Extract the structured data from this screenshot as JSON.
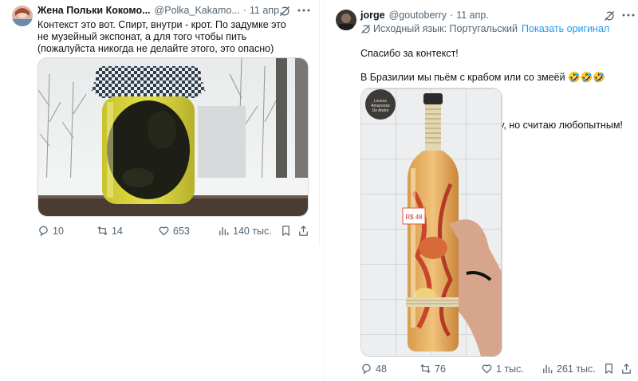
{
  "tweet1": {
    "author_name": "Жена Польки Кокомо...",
    "handle": "@Polka_Kakamo...",
    "separator": "·",
    "date": "11 апр.",
    "text": "Контекст это вот. Спирт, внутри - крот. По задумке это\nне музейный экспонат, а для того чтобы пить\n(пожалуйста никогда не делайте этого, это опасно)",
    "stats": {
      "replies": "10",
      "retweets": "14",
      "likes": "653",
      "views": "140 тыс."
    }
  },
  "tweet2": {
    "author_name": "jorge",
    "handle": "@goutoberry",
    "separator": "·",
    "date": "11 апр.",
    "source_language": "Исходный язык: Португальский",
    "show_original": "Показать оригинал",
    "text_line1": "Спасибо за контекст!",
    "text_line2": "В Бразилии мы пьём с крабом или со змеёй 🤣🤣🤣",
    "text_line3": "Никогда не пробовал и не буду, но считаю любопытным!",
    "bottle_label": "Licores Amazonas Do Andre",
    "price_tag": "R$ 48",
    "stats": {
      "replies": "48",
      "retweets": "76",
      "likes": "1 тыс.",
      "views": "261 тыс."
    }
  },
  "colors": {
    "text_primary": "#0f1419",
    "text_secondary": "#536471",
    "link": "#1d9bf0",
    "border": "#eff3f4"
  },
  "icons": [
    "grok-icon",
    "more-icon",
    "reply-icon",
    "retweet-icon",
    "like-icon",
    "views-icon",
    "bookmark-icon",
    "share-icon",
    "translate-icon"
  ]
}
